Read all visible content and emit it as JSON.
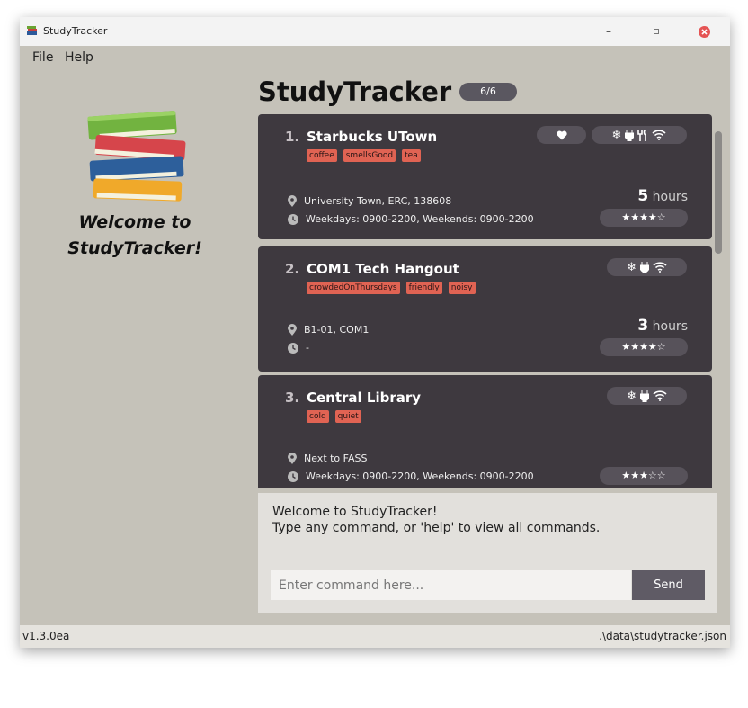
{
  "window": {
    "title": "StudyTracker",
    "icons": [
      "app-icon",
      "minimize-icon",
      "maximize-icon",
      "close-icon"
    ]
  },
  "menu": {
    "file": "File",
    "help": "Help"
  },
  "sidebar": {
    "welcome_line1": "Welcome to",
    "welcome_line2": "StudyTracker!"
  },
  "header": {
    "title": "StudyTracker",
    "count": "6/6"
  },
  "cards": [
    {
      "index": "1.",
      "name": "Starbucks UTown",
      "tags": [
        "coffee",
        "smellsGood",
        "tea"
      ],
      "favourite": true,
      "amenities": [
        "snowflake-icon",
        "plug-icon",
        "food-icon",
        "wifi-icon"
      ],
      "address": "University Town, ERC, 138608",
      "hours_text": "Weekdays: 0900-2200, Weekends: 0900-2200",
      "study_hours": "5",
      "hours_unit": "hours",
      "rating": "★★★★☆"
    },
    {
      "index": "2.",
      "name": "COM1 Tech Hangout",
      "tags": [
        "crowdedOnThursdays",
        "friendly",
        "noisy"
      ],
      "favourite": false,
      "amenities": [
        "snowflake-icon",
        "plug-icon",
        "wifi-icon"
      ],
      "address": "B1-01, COM1",
      "hours_text": "-",
      "study_hours": "3",
      "hours_unit": "hours",
      "rating": "★★★★☆"
    },
    {
      "index": "3.",
      "name": "Central Library",
      "tags": [
        "cold",
        "quiet"
      ],
      "favourite": false,
      "amenities": [
        "snowflake-icon",
        "plug-icon",
        "wifi-icon"
      ],
      "address": "Next to FASS",
      "hours_text": "Weekdays: 0900-2200, Weekends: 0900-2200",
      "rating": "★★★☆☆"
    }
  ],
  "result": {
    "line1": "Welcome to StudyTracker!",
    "line2": "Type any command, or 'help' to view all commands."
  },
  "command": {
    "placeholder": "Enter command here...",
    "value": "",
    "send_label": "Send"
  },
  "status": {
    "version": "v1.3.0ea",
    "file_path": ".\\data\\studytracker.json"
  },
  "colors": {
    "background": "#c5c2b9",
    "card": "#3e393f",
    "tag": "#e06353",
    "pill": "#57525a",
    "send": "#5f5b65"
  }
}
